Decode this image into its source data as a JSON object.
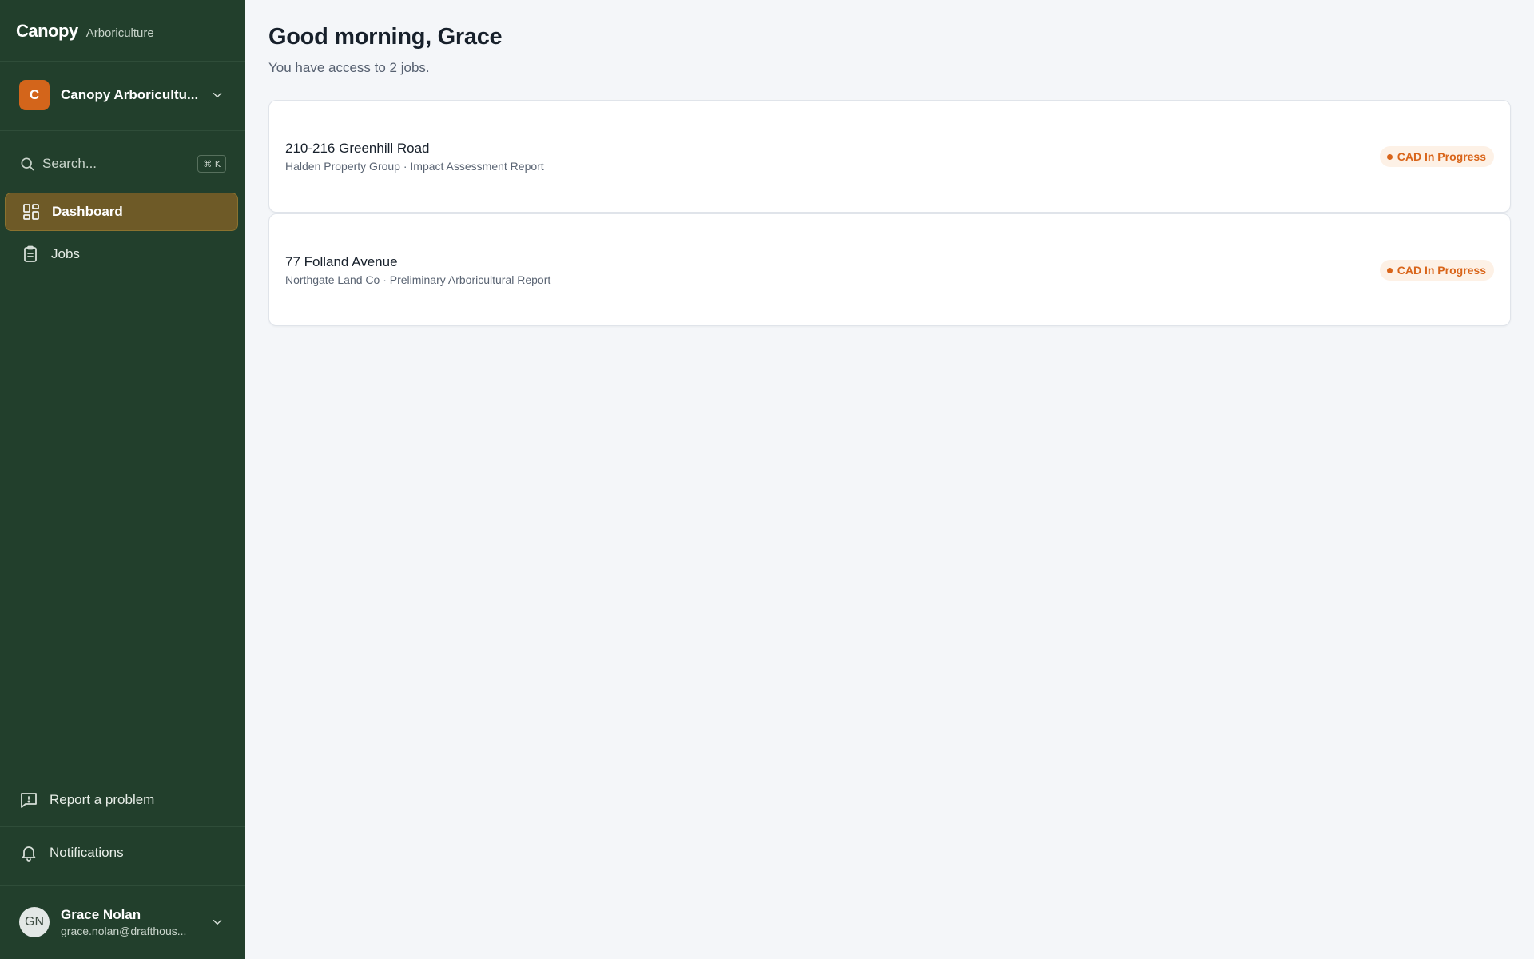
{
  "sidebar": {
    "brand": {
      "name": "Canopy",
      "subtitle": "Arboriculture"
    },
    "org": {
      "initial": "C",
      "name": "Canopy Arboricultu..."
    },
    "search": {
      "placeholder": "Search...",
      "shortcut": "⌘ K"
    },
    "nav": [
      {
        "label": "Dashboard",
        "icon": "dashboard-icon",
        "active": true
      },
      {
        "label": "Jobs",
        "icon": "clipboard-icon",
        "active": false
      }
    ],
    "footer": {
      "report_label": "Report a problem",
      "notifications_label": "Notifications"
    },
    "user": {
      "initials": "GN",
      "name": "Grace Nolan",
      "email": "grace.nolan@drafthous..."
    }
  },
  "main": {
    "greeting": "Good morning, Grace",
    "subtitle": "You have access to 2 jobs.",
    "jobs": [
      {
        "title": "210-216 Greenhill Road",
        "meta": "Halden Property Group · Impact Assessment Report",
        "status": "CAD In Progress"
      },
      {
        "title": "77 Folland Avenue",
        "meta": "Northgate Land Co · Preliminary Arboricultural Report",
        "status": "CAD In Progress"
      }
    ]
  },
  "colors": {
    "sidebar_bg": "#223f2c",
    "active_nav_bg": "#6e5a27",
    "org_avatar": "#d3651b",
    "status_accent": "#d9651a",
    "page_bg": "#f4f6f9"
  }
}
